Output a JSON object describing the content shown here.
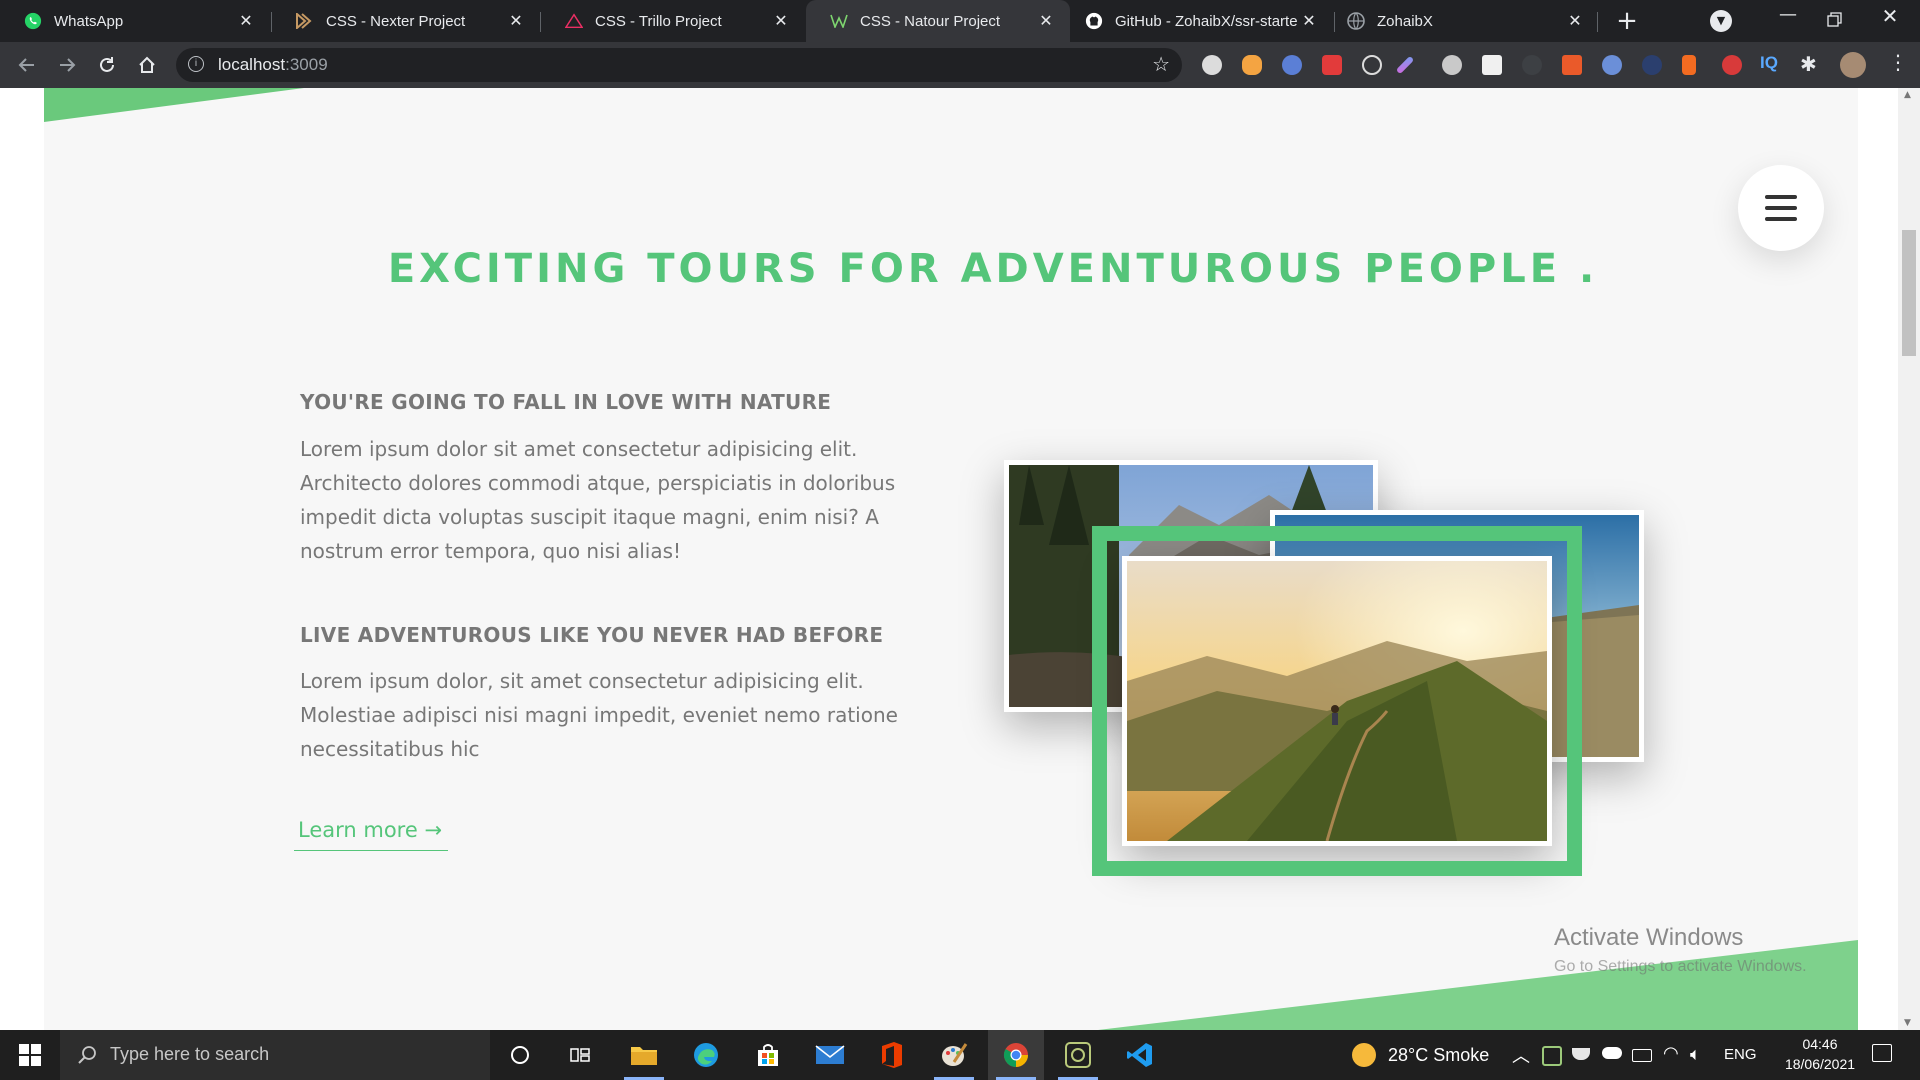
{
  "browser": {
    "tabs": [
      {
        "title": "WhatsApp",
        "icon": "whatsapp-icon",
        "active": false
      },
      {
        "title": "CSS - Nexter Project",
        "icon": "nexter-icon",
        "active": false
      },
      {
        "title": "CSS - Trillo Project",
        "icon": "trillo-icon",
        "active": false
      },
      {
        "title": "CSS - Natour Project",
        "icon": "natour-icon",
        "active": true
      },
      {
        "title": "GitHub - ZohaibX/ssr-starte",
        "icon": "github-icon",
        "active": false
      },
      {
        "title": "ZohaibX",
        "icon": "globe-icon",
        "active": false
      }
    ],
    "address": {
      "host": "localhost",
      "port": ":3009"
    }
  },
  "page": {
    "heading": "EXCITING TOURS FOR ADVENTUROUS PEOPLE .",
    "feature_1": {
      "title": "YOU'RE GOING TO FALL IN LOVE WITH NATURE",
      "text": "Lorem ipsum dolor sit amet consectetur adipisicing elit. Architecto dolores commodi atque, perspiciatis in doloribus impedit dicta voluptas suscipit itaque magni, enim nisi? A nostrum error tempora, quo nisi alias!"
    },
    "feature_2": {
      "title": "LIVE ADVENTUROUS LIKE YOU NEVER HAD BEFORE",
      "text": "Lorem ipsum dolor, sit amet consectetur adipisicing elit. Molestiae adipisci nisi magni impedit, eveniet nemo ratione necessitatibus hic"
    },
    "learn_more": "Learn more →",
    "accent_color": "#55c57a"
  },
  "watermark": {
    "title": "Activate Windows",
    "subtitle": "Go to Settings to activate Windows."
  },
  "taskbar": {
    "search_placeholder": "Type here to search",
    "weather": "28°C  Smoke",
    "language": "ENG",
    "time": "04:46",
    "date": "18/06/2021"
  }
}
